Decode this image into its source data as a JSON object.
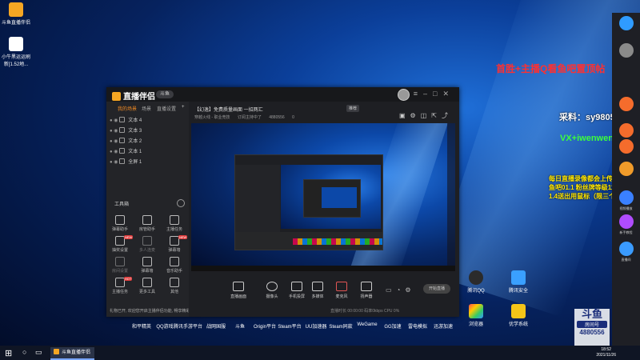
{
  "desktop": {
    "top_icons": [
      {
        "label": "斗鱼直播伴侣",
        "icon": "douyu-companion-icon",
        "color": "#f5a623"
      },
      {
        "label": "小牛黑运运刷新[1.52地...",
        "icon": "file-icon",
        "color": "#ffffff"
      }
    ],
    "dock_labels": [
      "和平精英",
      "QQ游戏",
      "腾讯手游平台",
      "战网国服",
      "斗鱼",
      "Origin平台",
      "Steam平台",
      "UU加速器",
      "Steam同款",
      "WeGame",
      "GG加速",
      "雷电模拟",
      "迅游加速"
    ],
    "right_icons": [
      {
        "label": "腾讯QQ",
        "icon": "penguin-icon"
      },
      {
        "label": "腾讯安全",
        "icon": "lock-icon"
      },
      {
        "label": "浏览器",
        "icon": "browser-icon"
      },
      {
        "label": "优学系统",
        "icon": "app-icon"
      }
    ]
  },
  "app": {
    "logo_text": "直播伴侣",
    "pill": "斗鱼",
    "left_tabs": [
      "我的场景",
      "场景",
      "直播设置"
    ],
    "sources": [
      "文本 4",
      "文本 3",
      "文本 2",
      "文本 1",
      "全屏 1"
    ],
    "tools_title": "工具箱",
    "tools": [
      {
        "label": "弹幕助手",
        "icon": "danmu-icon"
      },
      {
        "label": "房管助手",
        "icon": "admin-icon"
      },
      {
        "label": "主播任务",
        "icon": "task-icon"
      },
      {
        "label": "抽奖设置",
        "icon": "lottery-icon",
        "badge": "NEW"
      },
      {
        "label": "多人连麦",
        "icon": "mic-icon"
      },
      {
        "label": "弹幕墙",
        "icon": "wall-icon",
        "badge": "NEW"
      },
      {
        "label": "房间设置",
        "icon": "settings-icon"
      },
      {
        "label": "弹幕墙",
        "icon": "screen-icon"
      },
      {
        "label": "音乐助手",
        "icon": "music-icon"
      },
      {
        "label": "主播任务",
        "icon": "quest-icon",
        "badge": "HOT"
      },
      {
        "label": "更多工具",
        "icon": "download-icon"
      },
      {
        "label": "其他",
        "icon": "more-icon"
      }
    ],
    "footnote": "礼物已开, 欢迎您开启主播伴侣功能, 畅享精彩",
    "stream_title": "【幻逸】免费质量画面 一招两汇",
    "stream_tag": "推荐",
    "stream_sub": [
      "穿越火线 - 职业竞技",
      "订阅主持中了",
      "4880556",
      "0"
    ],
    "bottom_buttons": [
      {
        "label": "直播画面",
        "icon": "monitor-icon"
      },
      {
        "label": "摄像头",
        "icon": "camera-icon"
      },
      {
        "label": "手机投屏",
        "icon": "phone-icon"
      },
      {
        "label": "多媒体",
        "icon": "media-icon"
      },
      {
        "label": "麦克风",
        "icon": "mic-icon"
      },
      {
        "label": "扬声器",
        "icon": "speaker-icon"
      }
    ],
    "start_live": "开始直播",
    "status_line": "直播时长 00:00:00   码率0kbps   CPU 0%"
  },
  "overlay": {
    "red": "首胜+主播Q看鱼吧置顶帖",
    "white": "采料：sy980508",
    "green": "VX+iwenwen98",
    "yellow_lines": [
      "每日直播录像都会上传到鱼吧",
      "鱼吧01.1 粉丝牌等级11级送",
      "1.4送出用鼠标（限三个）"
    ]
  },
  "sidebar": {
    "items": [
      {
        "label": "",
        "color": "#2f9bff"
      },
      {
        "label": "",
        "color": "#8a8a8a"
      },
      {
        "label": "",
        "color": "#f56c2c"
      },
      {
        "label": "",
        "color": "#f56c2c"
      },
      {
        "label": "",
        "color": "#f56c2c"
      },
      {
        "label": "",
        "color": "#f09b2a"
      },
      {
        "label": "",
        "color": "#3a80ff"
      },
      {
        "label": "",
        "color": "#b04cff"
      },
      {
        "label": "",
        "color": "#3a9bff"
      }
    ],
    "captions": [
      "视频播放",
      "新手教程",
      "直播间"
    ]
  },
  "taskbar": {
    "app_label": "斗鱼直播伴侣",
    "time": "18:52",
    "date": "2021/11/26"
  },
  "douyu_badge": {
    "big": "斗鱼",
    "room": "房间号",
    "number": "4880556"
  }
}
